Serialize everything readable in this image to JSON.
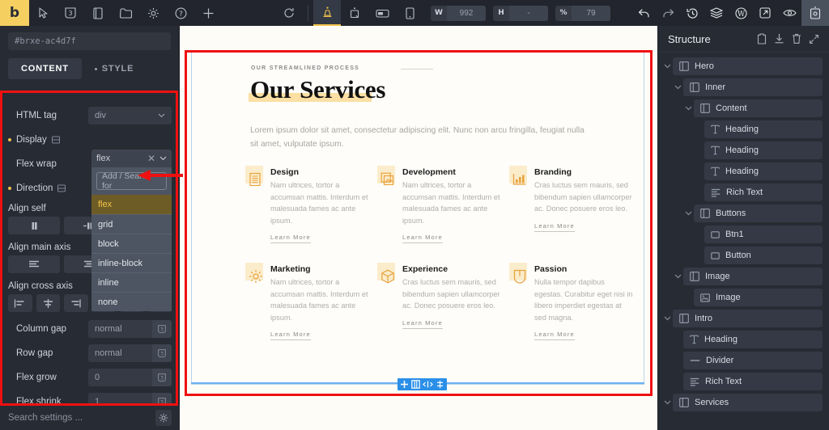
{
  "topbar": {
    "logo": "b",
    "left_icons": [
      "cursor-icon",
      "css-badge-icon",
      "page-icon",
      "folder-icon",
      "gear-icon",
      "help-icon",
      "plus-icon"
    ],
    "center_icons": [
      "refresh-icon",
      "desktop-icon",
      "tablet-landscape-icon",
      "tablet-icon",
      "mobile-icon"
    ],
    "width_label": "W",
    "width_value": "992",
    "height_label": "H",
    "height_value": "-",
    "zoom_label": "%",
    "zoom_value": "79",
    "right_icons": [
      "undo-icon",
      "redo-icon",
      "revisions-icon",
      "layers-icon",
      "wordpress-icon",
      "open-external-icon",
      "preview-icon",
      "save-template-icon"
    ]
  },
  "left_panel": {
    "element_id": "#brxe-ac4d7f",
    "tabs": [
      {
        "label": "CONTENT",
        "active": true
      },
      {
        "label": "STYLE",
        "active": false
      }
    ],
    "settings": [
      {
        "label": "HTML tag",
        "value": "div",
        "type": "select",
        "changed": false,
        "responsive": false
      },
      {
        "label": "Display",
        "value": "flex",
        "type": "select",
        "changed": true,
        "responsive": true
      },
      {
        "label": "Flex wrap",
        "value": "",
        "type": "select",
        "changed": false,
        "responsive": false
      },
      {
        "label": "Direction",
        "value": "",
        "type": "buttons",
        "changed": true,
        "responsive": true
      },
      {
        "label": "Align self",
        "value": "",
        "type": "buttons",
        "changed": false,
        "responsive": false
      },
      {
        "label": "Align main axis",
        "value": "",
        "type": "buttons",
        "changed": false,
        "responsive": false
      },
      {
        "label": "Align cross axis",
        "value": "",
        "type": "buttons",
        "changed": false,
        "responsive": false
      },
      {
        "label": "Column gap",
        "value": "normal",
        "type": "text",
        "changed": false,
        "responsive": false
      },
      {
        "label": "Row gap",
        "value": "normal",
        "type": "text",
        "changed": false,
        "responsive": false
      },
      {
        "label": "Flex grow",
        "value": "0",
        "type": "text",
        "changed": false,
        "responsive": false
      },
      {
        "label": "Flex shrink",
        "value": "1",
        "type": "text",
        "changed": false,
        "responsive": false
      }
    ],
    "dropdown": {
      "selected": "flex",
      "search_placeholder": "Add / Search for",
      "options": [
        "flex",
        "grid",
        "block",
        "inline-block",
        "inline",
        "none"
      ]
    },
    "search_placeholder": "Search settings ...",
    "labels": {
      "align_self": "Align self",
      "align_main_axis": "Align main axis",
      "align_cross_axis": "Align cross axis"
    }
  },
  "canvas": {
    "eyebrow": "OUR STREAMLINED PROCESS",
    "heading": "Our Services",
    "lead": "Lorem ipsum dolor sit amet, consectetur adipiscing elit. Nunc non arcu fringilla, feugiat nulla sit amet, vulputate ipsum.",
    "learn_more": "Learn More",
    "cards": [
      {
        "icon": "document-list-icon",
        "title": "Design",
        "desc": "Nam ultrices, tortor a accumsan mattis. Interdum et malesuada fames ac ante ipsum."
      },
      {
        "icon": "image-stack-icon",
        "title": "Development",
        "desc": "Nam ultrices, tortor a accumsan mattis. Interdum et malesuada fames ac ante ipsum."
      },
      {
        "icon": "bar-chart-icon",
        "title": "Branding",
        "desc": "Cras luctus sem mauris, sed bibendum sapien ullamcorper ac. Donec posuere eros leo."
      },
      {
        "icon": "gear-icon",
        "title": "Marketing",
        "desc": "Nam ultrices, tortor a accumsan mattis. Interdum et malesuada fames ac ante ipsum."
      },
      {
        "icon": "box-icon",
        "title": "Experience",
        "desc": "Cras luctus sem mauris, sed bibendum sapien ullamcorper ac. Donec posuere eros leo."
      },
      {
        "icon": "shield-icon",
        "title": "Passion",
        "desc": "Nulla tempor dapibus egestas. Curabitur eget nisi in libero imperdiet egestas at sed magna."
      }
    ],
    "float_toolbar_icons": [
      "add-icon",
      "duplicate-icon",
      "move-horizontal-icon",
      "move-vertical-icon"
    ]
  },
  "right_panel": {
    "title": "Structure",
    "header_icons": [
      "copy-icon",
      "download-icon",
      "trash-icon",
      "collapse-icon"
    ],
    "tree": [
      {
        "label": "Hero",
        "icon": "block-icon",
        "depth": 0,
        "chevron": true
      },
      {
        "label": "Inner",
        "icon": "block-icon",
        "depth": 1,
        "chevron": true
      },
      {
        "label": "Content",
        "icon": "block-icon",
        "depth": 2,
        "chevron": true
      },
      {
        "label": "Heading",
        "icon": "text-icon",
        "depth": 3,
        "chevron": false
      },
      {
        "label": "Heading",
        "icon": "text-icon",
        "depth": 3,
        "chevron": false
      },
      {
        "label": "Heading",
        "icon": "text-icon",
        "depth": 3,
        "chevron": false
      },
      {
        "label": "Rich Text",
        "icon": "rich-text-icon",
        "depth": 3,
        "chevron": false
      },
      {
        "label": "Buttons",
        "icon": "block-icon",
        "depth": 2,
        "chevron": true
      },
      {
        "label": "Btn1",
        "icon": "button-icon",
        "depth": 3,
        "chevron": false
      },
      {
        "label": "Button",
        "icon": "button-icon",
        "depth": 3,
        "chevron": false
      },
      {
        "label": "Image",
        "icon": "block-icon",
        "depth": 1,
        "chevron": true
      },
      {
        "label": "Image",
        "icon": "image-icon",
        "depth": 2,
        "chevron": false
      },
      {
        "label": "Intro",
        "icon": "block-icon",
        "depth": 0,
        "chevron": true
      },
      {
        "label": "Heading",
        "icon": "text-icon",
        "depth": 1,
        "chevron": false
      },
      {
        "label": "Divider",
        "icon": "divider-icon",
        "depth": 1,
        "chevron": false
      },
      {
        "label": "Rich Text",
        "icon": "rich-text-icon",
        "depth": 1,
        "chevron": false
      },
      {
        "label": "Services",
        "icon": "block-icon",
        "depth": 0,
        "chevron": true
      }
    ]
  },
  "colors": {
    "accent_yellow": "#f5d061",
    "annotation_red": "#ee1111",
    "panel_bg": "#272b33",
    "topbar_bg": "#22252d",
    "selection_blue": "#2b8fe8",
    "highlight_gold": "#6e5c26"
  }
}
